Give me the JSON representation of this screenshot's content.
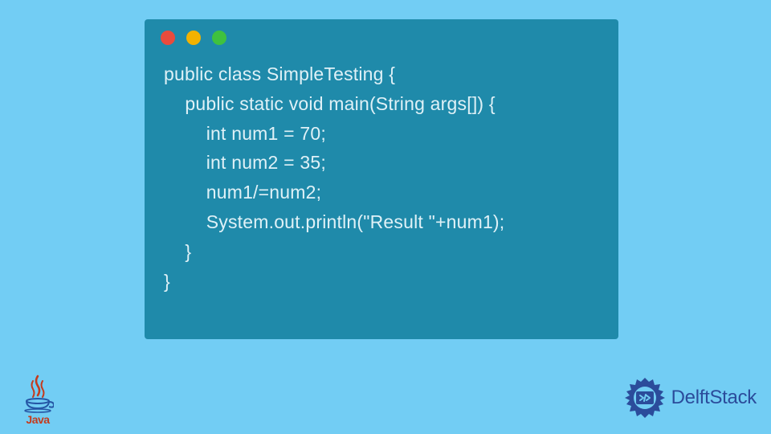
{
  "code": {
    "lines": [
      "public class SimpleTesting {",
      "    public static void main(String args[]) {",
      "        int num1 = 70;",
      "        int num2 = 35;",
      "        num1/=num2;",
      "        System.out.println(\"Result \"+num1);",
      "    }",
      "}"
    ]
  },
  "logos": {
    "java_label": "Java",
    "delft_label": "DelftStack"
  },
  "window": {
    "dots": [
      "red",
      "yellow",
      "green"
    ]
  }
}
